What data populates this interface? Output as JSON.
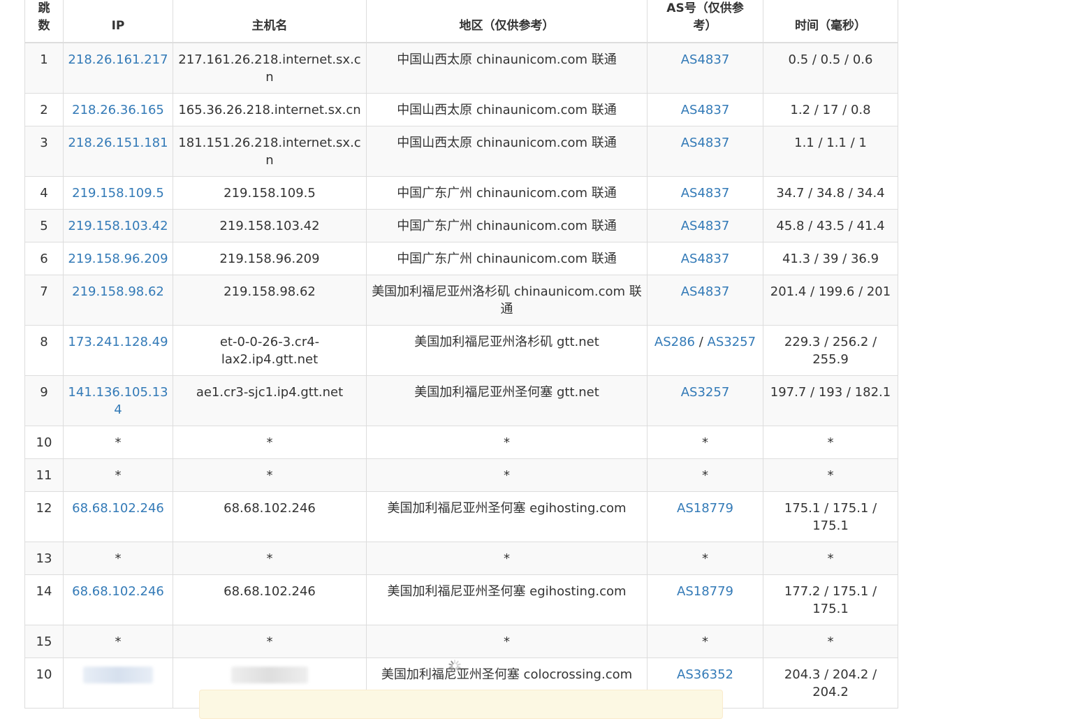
{
  "table": {
    "headers": {
      "hop": "跳数",
      "ip": "IP",
      "hostname": "主机名",
      "region": "地区（仅供参考）",
      "asn": "AS号（仅供参考）",
      "time": "时间（毫秒）"
    },
    "rows": [
      {
        "hop": "1",
        "ip": "218.26.161.217",
        "hostname": "217.161.26.218.internet.sx.cn",
        "region": "中国山西太原 chinaunicom.com 联通",
        "asn": [
          "AS4837"
        ],
        "time": "0.5 / 0.5 / 0.6"
      },
      {
        "hop": "2",
        "ip": "218.26.36.165",
        "hostname": "165.36.26.218.internet.sx.cn",
        "region": "中国山西太原 chinaunicom.com 联通",
        "asn": [
          "AS4837"
        ],
        "time": "1.2 / 17 / 0.8"
      },
      {
        "hop": "3",
        "ip": "218.26.151.181",
        "hostname": "181.151.26.218.internet.sx.cn",
        "region": "中国山西太原 chinaunicom.com 联通",
        "asn": [
          "AS4837"
        ],
        "time": "1.1 / 1.1 / 1"
      },
      {
        "hop": "4",
        "ip": "219.158.109.5",
        "hostname": "219.158.109.5",
        "region": "中国广东广州 chinaunicom.com 联通",
        "asn": [
          "AS4837"
        ],
        "time": "34.7 / 34.8 / 34.4"
      },
      {
        "hop": "5",
        "ip": "219.158.103.42",
        "hostname": "219.158.103.42",
        "region": "中国广东广州 chinaunicom.com 联通",
        "asn": [
          "AS4837"
        ],
        "time": "45.8 / 43.5 / 41.4"
      },
      {
        "hop": "6",
        "ip": "219.158.96.209",
        "hostname": "219.158.96.209",
        "region": "中国广东广州 chinaunicom.com 联通",
        "asn": [
          "AS4837"
        ],
        "time": "41.3 / 39 / 36.9"
      },
      {
        "hop": "7",
        "ip": "219.158.98.62",
        "hostname": "219.158.98.62",
        "region": "美国加利福尼亚州洛杉矶 chinaunicom.com 联通",
        "asn": [
          "AS4837"
        ],
        "time": "201.4 / 199.6 / 201"
      },
      {
        "hop": "8",
        "ip": "173.241.128.49",
        "hostname": "et-0-0-26-3.cr4-lax2.ip4.gtt.net",
        "region": "美国加利福尼亚州洛杉矶 gtt.net",
        "asn": [
          "AS286",
          "AS3257"
        ],
        "time": "229.3 / 256.2 / 255.9"
      },
      {
        "hop": "9",
        "ip": "141.136.105.134",
        "hostname": "ae1.cr3-sjc1.ip4.gtt.net",
        "region": "美国加利福尼亚州圣何塞 gtt.net",
        "asn": [
          "AS3257"
        ],
        "time": "197.7 / 193 / 182.1"
      },
      {
        "hop": "10",
        "ip": "*",
        "hostname": "*",
        "region": "*",
        "asn": [],
        "asn_text": "*",
        "time": "*"
      },
      {
        "hop": "11",
        "ip": "*",
        "hostname": "*",
        "region": "*",
        "asn": [],
        "asn_text": "*",
        "time": "*"
      },
      {
        "hop": "12",
        "ip": "68.68.102.246",
        "hostname": "68.68.102.246",
        "region": "美国加利福尼亚州圣何塞 egihosting.com",
        "asn": [
          "AS18779"
        ],
        "time": "175.1 / 175.1 / 175.1"
      },
      {
        "hop": "13",
        "ip": "*",
        "hostname": "*",
        "region": "*",
        "asn": [],
        "asn_text": "*",
        "time": "*"
      },
      {
        "hop": "14",
        "ip": "68.68.102.246",
        "hostname": "68.68.102.246",
        "region": "美国加利福尼亚州圣何塞 egihosting.com",
        "asn": [
          "AS18779"
        ],
        "time": "177.2 / 175.1 / 175.1"
      },
      {
        "hop": "15",
        "ip": "*",
        "hostname": "*",
        "region": "*",
        "asn": [],
        "asn_text": "*",
        "time": "*"
      },
      {
        "hop": "10",
        "ip": "",
        "hostname": "",
        "region": "美国加利福尼亚州圣何塞 colocrossing.com",
        "asn": [
          "AS36352"
        ],
        "time": "204.3 / 204.2 / 204.2",
        "redacted": true
      }
    ]
  },
  "asn_separator": " / ",
  "colors": {
    "link": "#337ab7",
    "border": "#dddddd",
    "stripe": "#f9f9f9",
    "notice_bg": "#fcf8e3"
  },
  "icons": {
    "loading": "spinner-icon"
  }
}
